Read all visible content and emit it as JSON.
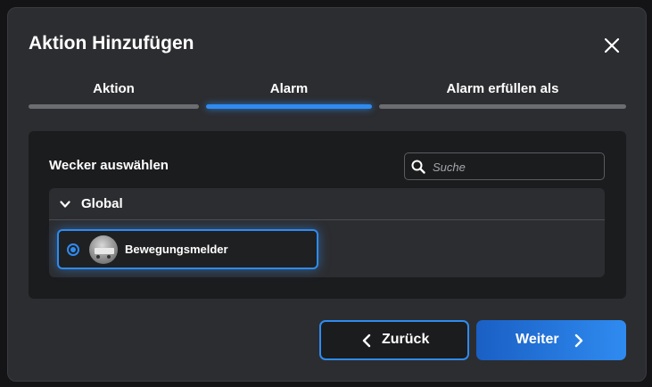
{
  "dialog": {
    "title": "Aktion Hinzufügen",
    "close_icon": "close-icon"
  },
  "steps": [
    {
      "label": "Aktion",
      "active": false
    },
    {
      "label": "Alarm",
      "active": true
    },
    {
      "label": "Alarm erfüllen als",
      "active": false
    }
  ],
  "panel": {
    "label": "Wecker auswählen",
    "search": {
      "placeholder": "Suche",
      "icon": "search-icon"
    },
    "group": {
      "label": "Global",
      "icon": "chevron-down-icon",
      "items": [
        {
          "label": "Bewegungsmelder",
          "selected": true,
          "icon": "avatar"
        }
      ]
    }
  },
  "footer": {
    "back_label": "Zurück",
    "back_icon": "chevron-left-icon",
    "next_label": "Weiter",
    "next_icon": "chevron-right-icon"
  },
  "colors": {
    "accent": "#2f8bf0",
    "dialog_bg": "#2c2d30",
    "panel_bg": "#1b1c1e",
    "inactive_bar": "#6b6d72"
  }
}
